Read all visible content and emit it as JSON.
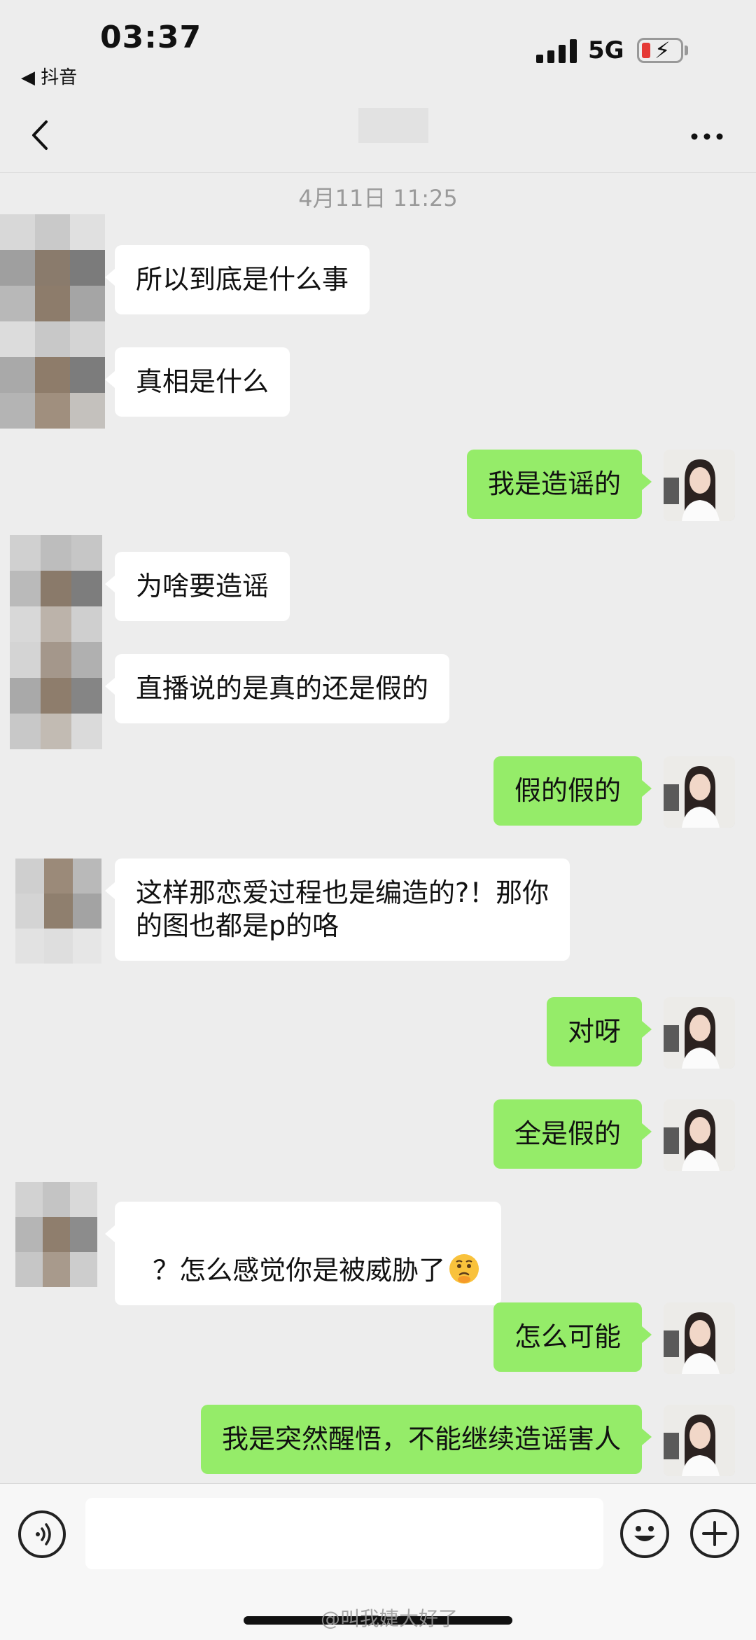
{
  "status_bar": {
    "time": "03:37",
    "back_app": "◀ 抖音",
    "network": "5G"
  },
  "nav": {
    "title": ""
  },
  "timestamp": "4月11日 11:25",
  "messages": [
    {
      "side": "in",
      "text": "所以到底是什么事"
    },
    {
      "side": "in",
      "text": "真相是什么"
    },
    {
      "side": "out",
      "text": "我是造谣的"
    },
    {
      "side": "in",
      "text": "为啥要造谣"
    },
    {
      "side": "in",
      "text": "直播说的是真的还是假的"
    },
    {
      "side": "out",
      "text": "假的假的"
    },
    {
      "side": "in",
      "text": "这样那恋爱过程也是编造的?！那你\n的图也都是p的咯"
    },
    {
      "side": "out",
      "text": "对呀"
    },
    {
      "side": "out",
      "text": "全是假的"
    },
    {
      "side": "in",
      "text": "？怎么感觉你是被威胁了"
    },
    {
      "side": "out",
      "text": "怎么可能"
    },
    {
      "side": "out",
      "text": "我是突然醒悟，不能继续造谣害人"
    }
  ],
  "input": {
    "value": ""
  },
  "watermark": "@叫我婕大好了"
}
